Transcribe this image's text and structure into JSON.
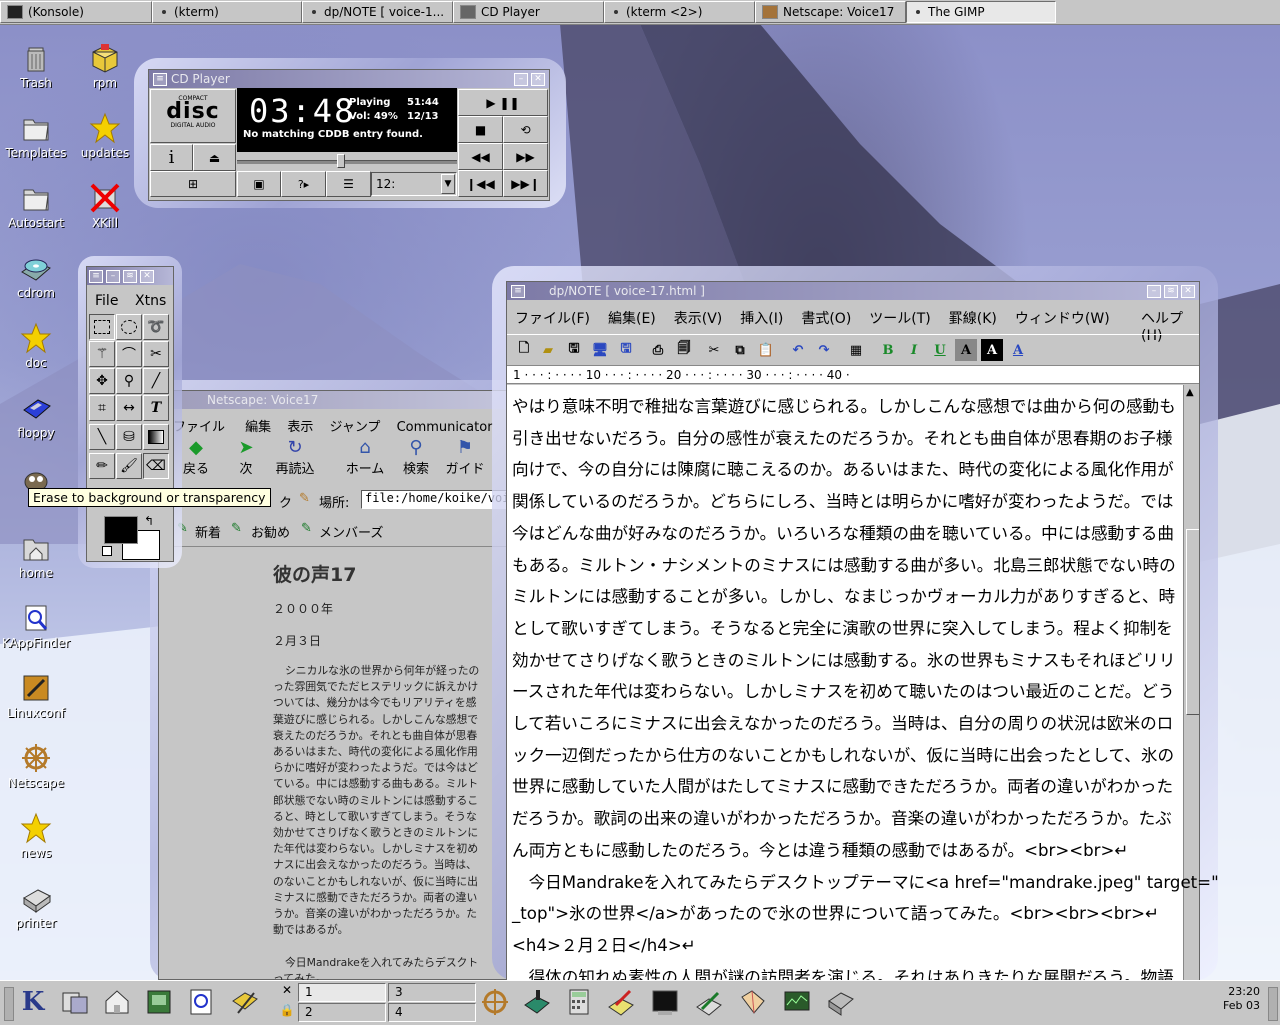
{
  "taskbar": {
    "items": [
      {
        "label": "(Konsole)"
      },
      {
        "label": "(kterm)"
      },
      {
        "label": "dp/NOTE [ voice-1..."
      },
      {
        "label": "CD Player"
      },
      {
        "label": "(kterm <2>)"
      },
      {
        "label": "Netscape: Voice17"
      },
      {
        "label": "The GIMP"
      }
    ]
  },
  "desktop_icons": [
    {
      "label": "Trash",
      "icon": "trash-icon"
    },
    {
      "label": "rpm",
      "icon": "package-icon"
    },
    {
      "label": "Templates",
      "icon": "folder-icon"
    },
    {
      "label": "updates",
      "icon": "star-icon"
    },
    {
      "label": "Autostart",
      "icon": "folder-icon"
    },
    {
      "label": "XKill",
      "icon": "xkill-icon"
    },
    {
      "label": "cdrom",
      "icon": "cdrom-icon"
    },
    {
      "label": "doc",
      "icon": "star-icon"
    },
    {
      "label": "floppy",
      "icon": "floppy-icon"
    },
    {
      "label": "home",
      "icon": "home-icon"
    },
    {
      "label": "KAppFinder",
      "icon": "finder-icon"
    },
    {
      "label": "Linuxconf",
      "icon": "tools-icon"
    },
    {
      "label": "Netscape",
      "icon": "netscape-wheel-icon"
    },
    {
      "label": "news",
      "icon": "star-icon"
    },
    {
      "label": "printer",
      "icon": "printer-icon"
    }
  ],
  "cdplayer": {
    "title": "CD Player",
    "logo_top": "COMPACT",
    "logo_main": "disc",
    "logo_bottom": "DIGITAL AUDIO",
    "time": "03:48",
    "status": "Playing",
    "total": "51:44",
    "volume": "Vol: 49%",
    "track": "12/13",
    "message": "No matching CDDB entry found.",
    "track_select": "12:",
    "progress": 0.47
  },
  "gimp": {
    "menu": [
      "File",
      "Xtns"
    ],
    "tooltip": "Erase to background or transparency",
    "fg_color": "#000000",
    "bg_color": "#ffffff"
  },
  "netscape": {
    "title": "Netscape: Voice17",
    "menu": [
      "ファイル",
      "編集",
      "表示",
      "ジャンプ",
      "Communicator"
    ],
    "toolbar": [
      "戻る",
      "次",
      "再読込",
      "ホーム",
      "検索",
      "ガイド"
    ],
    "location_label": "場所:",
    "location_value": "file:/home/koike/voic",
    "bookmark_label": "ク",
    "personal": [
      "新着",
      "お勧め",
      "メンバーズ"
    ],
    "page_title": "彼の声17",
    "year": "２０００年",
    "date": "２月３日",
    "body_lines": [
      "シニカルな氷の世界から何年が経ったの",
      "った雰囲気でただヒステリックに訴えかけ",
      "ついては、幾分かは今でもリアリティを感",
      "葉遊びに感じられる。しかしこんな感想で",
      "衰えたのだろうか。それとも曲自体が思春",
      "あるいはまた、時代の変化による風化作用",
      "らかに嗜好が変わったようだ。では今はど",
      "ている。中には感動する曲もある。ミルト",
      "郎状態でない時のミルトンには感動するこ",
      "ると、時として歌いすぎてしまう。そうな",
      "効かせてさりげなく歌うときのミルトンに",
      "た年代は変わらない。しかしミナスを初め",
      "ナスに出会えなかったのだろう。当時は、",
      "のないことかもしれないが、仮に当時に出",
      "ミナスに感動できただろうか。両者の違い",
      "うか。音楽の違いがわかっただろうか。た",
      "動ではあるが。",
      "",
      "今日Mandrakeを入れてみたらデスクト",
      "ってみた。"
    ]
  },
  "dpnote": {
    "title": "dp/NOTE [ voice-17.html ]",
    "menu": [
      "ファイル(F)",
      "編集(E)",
      "表示(V)",
      "挿入(I)",
      "書式(O)",
      "ツール(T)",
      "罫線(K)",
      "ウィンドウ(W)",
      "ヘルプ(H)"
    ],
    "format_buttons": [
      "B",
      "I",
      "U",
      "A",
      "A",
      "A"
    ],
    "ruler": "1 · · · : · · · · 10 · · · : · · · · 20 · · · : · · · · 30 · · · : · · · · 40 ·",
    "lines": [
      "やはり意味不明で稚拙な言葉遊びに感じられる。しかしこんな感想では曲から何の感動も",
      "引き出せないだろう。自分の感性が衰えたのだろうか。それとも曲自体が思春期のお子様",
      "向けで、今の自分には陳腐に聴こえるのか。あるいはまた、時代の変化による風化作用が",
      "関係しているのだろうか。どちらにしろ、当時とは明らかに嗜好が変わったようだ。では",
      "今はどんな曲が好みなのだろうか。いろいろな種類の曲を聴いている。中には感動する曲",
      "もある。ミルトン・ナシメントのミナスには感動する曲が多い。北島三郎状態でない時の",
      "ミルトンには感動することが多い。しかし、なまじっかヴォーカル力がありすぎると、時",
      "として歌いすぎてしまう。そうなると完全に演歌の世界に突入してしまう。程よく抑制を",
      "効かせてさりげなく歌うときのミルトンには感動する。氷の世界もミナスもそれほどリリ",
      "ースされた年代は変わらない。しかしミナスを初めて聴いたのはつい最近のことだ。どう",
      "して若いころにミナスに出会えなかったのだろう。当時は、自分の周りの状況は欧米のロ",
      "ック一辺倒だったから仕方のないことかもしれないが、仮に当時に出会ったとして、氷の",
      "世界に感動していた人間がはたしてミナスに感動できただろうか。両者の違いがわかった",
      "だろうか。歌詞の出来の違いがわかっただろうか。音楽の違いがわかっただろうか。たぶ",
      "ん両方ともに感動したのだろう。今とは違う種類の感動ではあるが。<br><br>↵",
      "　今日Mandrakeを入れてみたらデスクトップテーマに<a href=\"mandrake.jpeg\" target=\"",
      "_top\">氷の世界</a>があったので氷の世界について語ってみた。<br><br><br>↵",
      "<h4>２月２日</h4>↵",
      "　得体の知れぬ素性の人間が謎の訪問者を演じる。それはありきたりな展開だろう。物語"
    ]
  },
  "panel": {
    "pagers": [
      "1",
      "2",
      "3",
      "4"
    ],
    "clock_time": "23:20",
    "clock_date": "Feb 03"
  }
}
